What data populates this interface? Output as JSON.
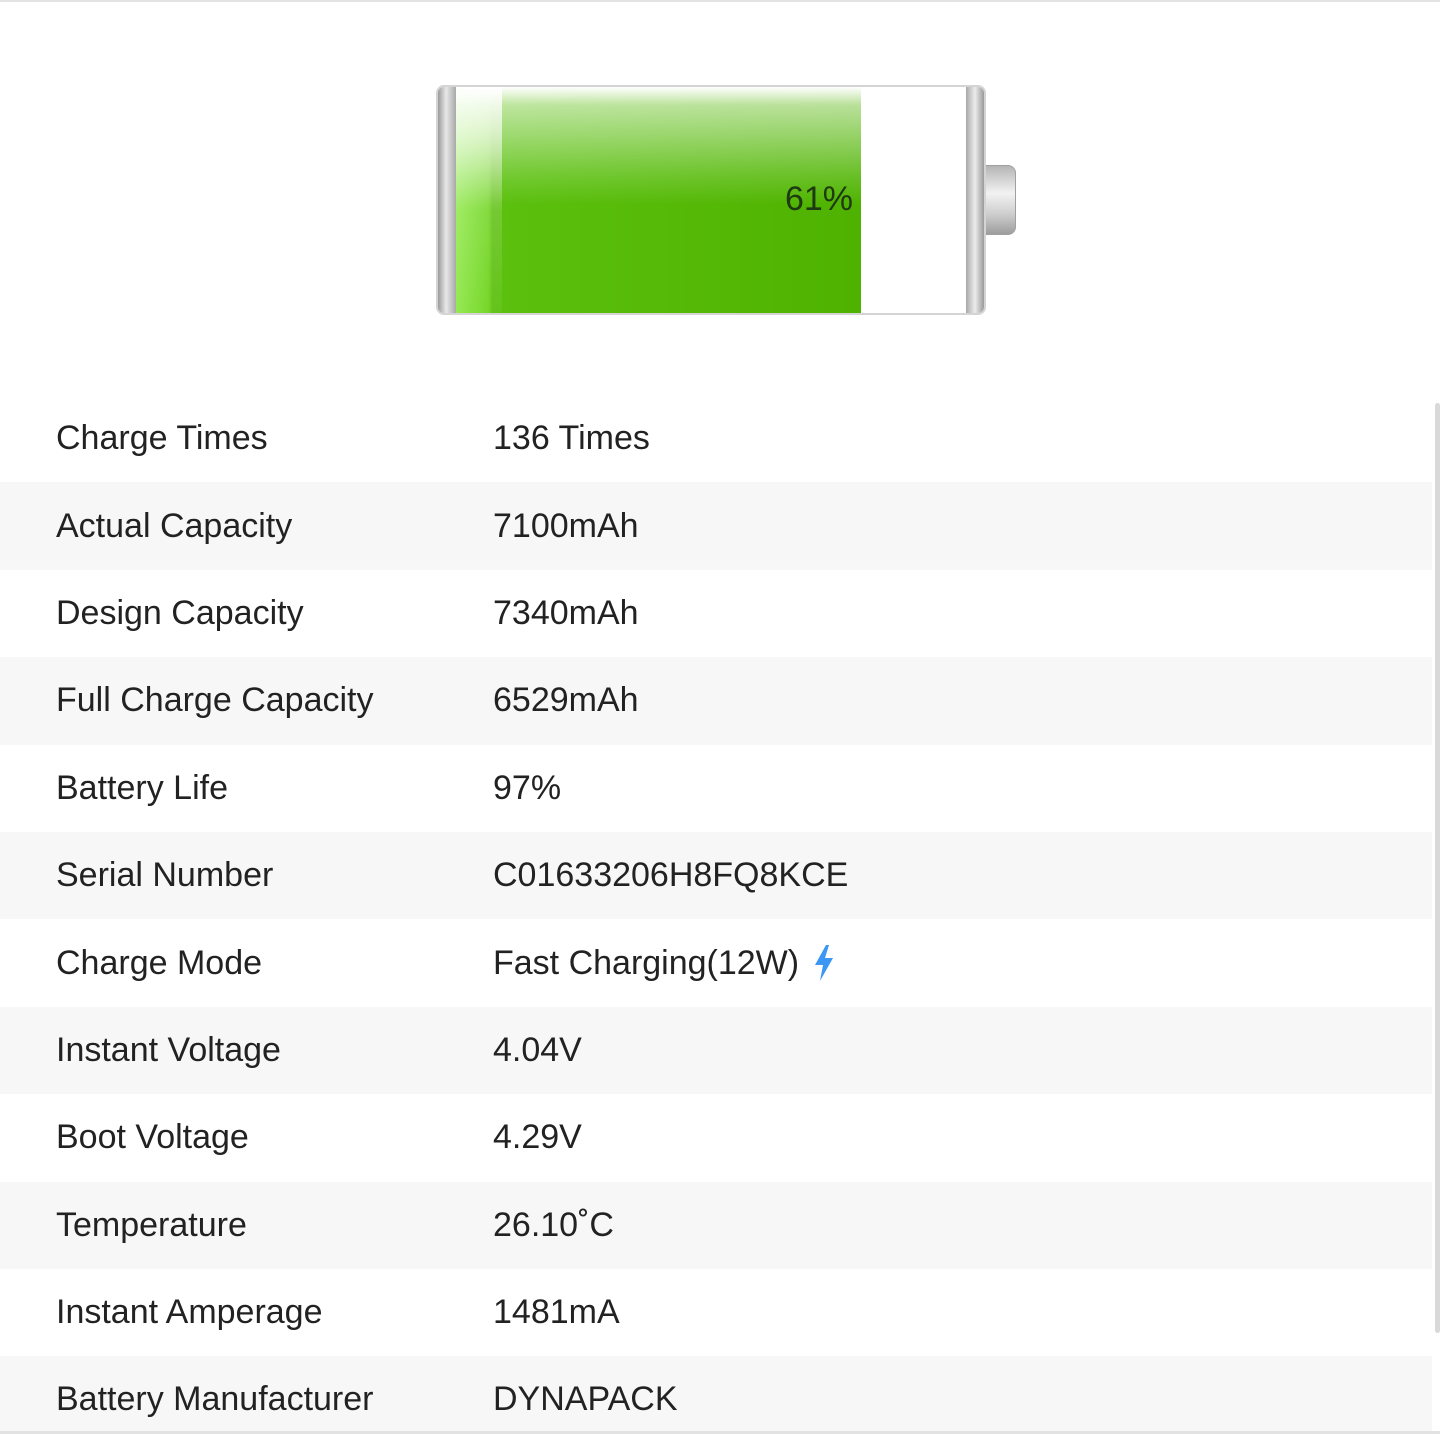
{
  "battery": {
    "level": 0.61,
    "percent_label": "61%",
    "fill_color": "#4fb200"
  },
  "rows": [
    {
      "label": "Charge Times",
      "value": "136 Times"
    },
    {
      "label": "Actual Capacity",
      "value": "7100mAh"
    },
    {
      "label": "Design Capacity",
      "value": "7340mAh"
    },
    {
      "label": "Full Charge Capacity",
      "value": "6529mAh"
    },
    {
      "label": "Battery Life",
      "value": "97%"
    },
    {
      "label": "Serial Number",
      "value": "C01633206H8FQ8KCE"
    },
    {
      "label": "Charge Mode",
      "value": "Fast Charging(12W)",
      "icon": "lightning-bolt-icon",
      "icon_color": "#3c97f3"
    },
    {
      "label": "Instant Voltage",
      "value": "4.04V"
    },
    {
      "label": "Boot Voltage",
      "value": "4.29V"
    },
    {
      "label": "Temperature",
      "value": "26.10˚C"
    },
    {
      "label": "Instant Amperage",
      "value": "1481mA"
    },
    {
      "label": "Battery Manufacturer",
      "value": "DYNAPACK"
    }
  ]
}
